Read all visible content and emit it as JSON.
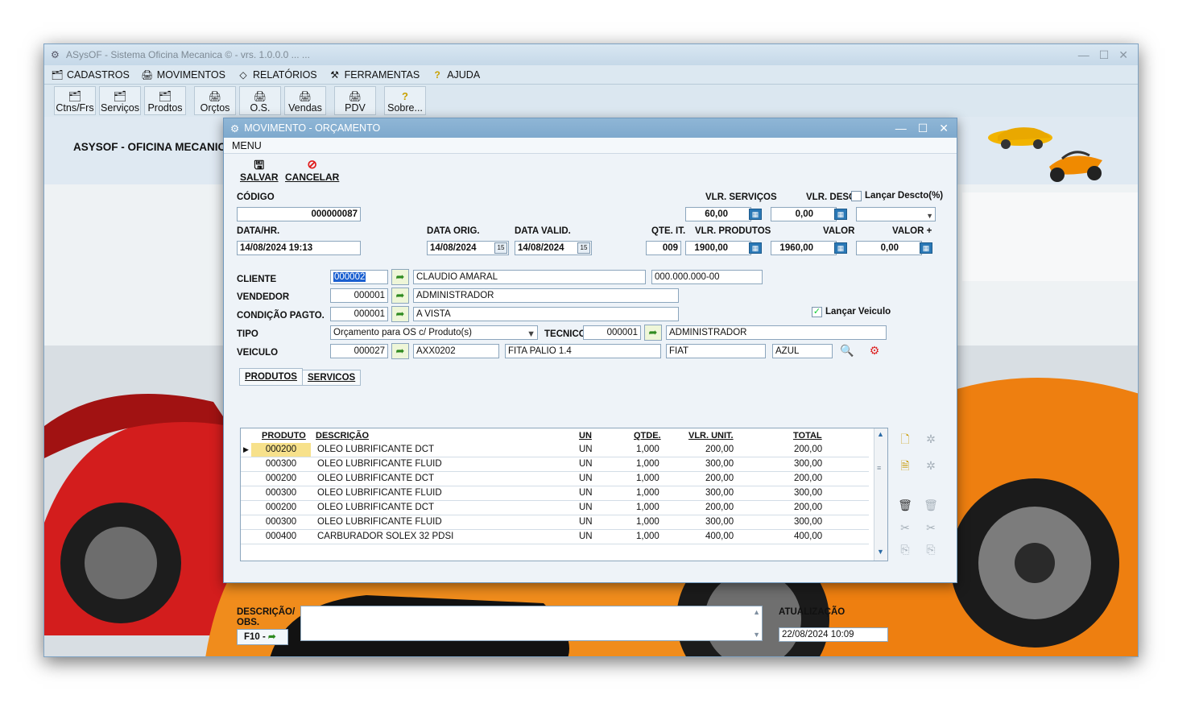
{
  "main_window": {
    "title": "ASysOF - Sistema Oficina Mecanica © - vrs. 1.0.0.0 ... ...",
    "controls": [
      "—",
      "☐",
      "✕"
    ],
    "menu": [
      {
        "label": "CADASTROS",
        "icon": "cadastros-icon"
      },
      {
        "label": "MOVIMENTOS",
        "icon": "movimentos-icon"
      },
      {
        "label": "RELATÓRIOS",
        "icon": "relatorios-icon"
      },
      {
        "label": "FERRAMENTAS",
        "icon": "ferramentas-icon"
      },
      {
        "label": "AJUDA",
        "icon": "help-icon"
      }
    ],
    "toolbar": [
      {
        "label": "Ctns/Frs"
      },
      {
        "label": "Serviços"
      },
      {
        "label": "Prodtos"
      },
      {
        "label": "Orçtos"
      },
      {
        "label": "O.S."
      },
      {
        "label": "Vendas"
      },
      {
        "label": "PDV"
      },
      {
        "label": "Sobre..."
      }
    ],
    "brand": "ASYSOF - OFICINA MECANICA"
  },
  "dialog": {
    "title": "MOVIMENTO - ORÇAMENTO",
    "menu": "MENU",
    "actions": {
      "save": "SALVAR",
      "cancel": "CANCELAR"
    },
    "labels": {
      "codigo": "CÓDIGO",
      "vlr_servicos": "VLR. SERVIÇOS",
      "vlr_desc": "VLR. DESC.",
      "lancar_desconto": "Lançar Descto(%)",
      "data_hr": "DATA/HR.",
      "data_orig": "DATA ORIG.",
      "data_valid": "DATA VALID.",
      "qte_it": "QTE. IT.",
      "vlr_produtos": "VLR. PRODUTOS",
      "valor": "VALOR",
      "valor_mais": "VALOR +",
      "cliente": "CLIENTE",
      "vendedor": "VENDEDOR",
      "condicao": "CONDIÇÃO PAGTO.",
      "tipo": "TIPO",
      "tecnico": "TECNICO",
      "veiculo": "VEICULO",
      "lancar_veiculo": "Lançar Veiculo",
      "descricao_obs": "DESCRIÇÃO/ OBS.",
      "atualizacao": "ATUALIZAÇÃO",
      "f10": "F10 -"
    },
    "values": {
      "codigo": "000000087",
      "vlr_servicos": "60,00",
      "vlr_desc": "0,00",
      "data_hr": "14/08/2024 19:13",
      "data_orig": "14/08/2024",
      "data_valid": "14/08/2024",
      "qte_it": "009",
      "vlr_produtos": "1900,00",
      "valor": "1960,00",
      "valor_mais": "0,00",
      "cliente_cod": "000002",
      "cliente_nome": "CLAUDIO AMARAL",
      "cliente_doc": "000.000.000-00",
      "vendedor_cod": "000001",
      "vendedor_nome": "ADMINISTRADOR",
      "condicao_cod": "000001",
      "condicao_nome": "A VISTA",
      "tipo": "Orçamento para OS c/ Produto(s)",
      "tecnico_cod": "000001",
      "tecnico_nome": "ADMINISTRADOR",
      "veiculo_cod": "000027",
      "placa": "AXX0202",
      "modelo": "FITA PALIO 1.4",
      "marca": "FIAT",
      "cor": "AZUL",
      "atualizacao": "22/08/2024 10:09"
    },
    "tabs": [
      "PRODUTOS",
      "SERVICOS"
    ],
    "grid": {
      "headers": [
        "PRODUTO",
        "DESCRIÇÃO",
        "UN",
        "QTDE.",
        "VLR. UNIT.",
        "TOTAL"
      ],
      "rows": [
        [
          "000200",
          "OLEO LUBRIFICANTE DCT",
          "UN",
          "1,000",
          "200,00",
          "200,00"
        ],
        [
          "000300",
          "OLEO LUBRIFICANTE FLUID",
          "UN",
          "1,000",
          "300,00",
          "300,00"
        ],
        [
          "000200",
          "OLEO LUBRIFICANTE DCT",
          "UN",
          "1,000",
          "200,00",
          "200,00"
        ],
        [
          "000300",
          "OLEO LUBRIFICANTE FLUID",
          "UN",
          "1,000",
          "300,00",
          "300,00"
        ],
        [
          "000200",
          "OLEO LUBRIFICANTE DCT",
          "UN",
          "1,000",
          "200,00",
          "200,00"
        ],
        [
          "000300",
          "OLEO LUBRIFICANTE FLUID",
          "UN",
          "1,000",
          "300,00",
          "300,00"
        ],
        [
          "000400",
          "CARBURADOR SOLEX 32 PDSI",
          "UN",
          "1,000",
          "400,00",
          "400,00"
        ]
      ]
    },
    "colors": {
      "accent": "#2a78b6",
      "selected_cell": "#f7e18b",
      "titlebar": "#8fb6d6"
    }
  }
}
